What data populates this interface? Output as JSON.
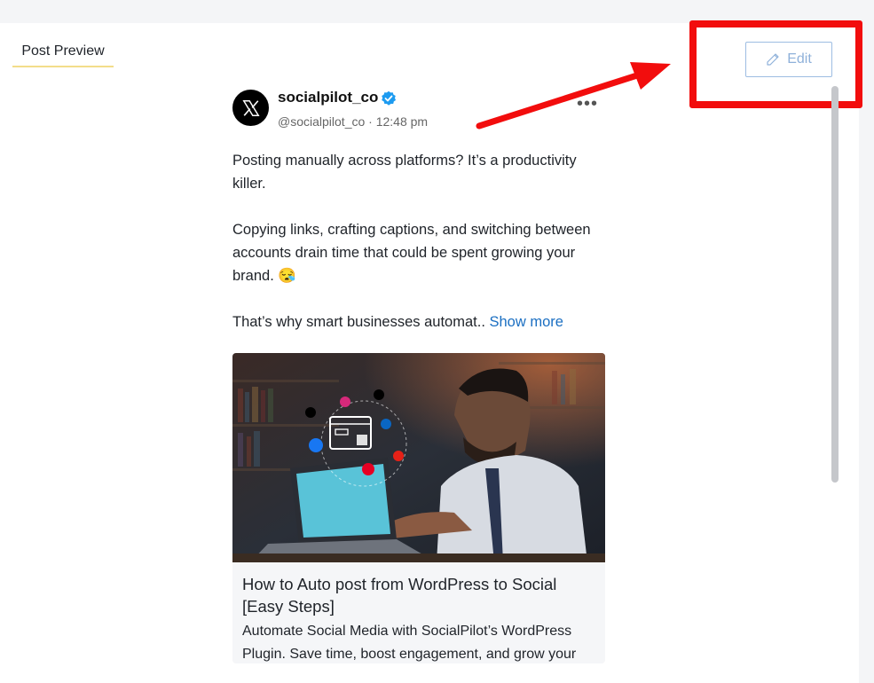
{
  "tab": {
    "label": "Post Preview"
  },
  "edit": {
    "label": "Edit"
  },
  "post": {
    "account_name": "socialpilot_co",
    "handle": "@socialpilot_co",
    "separator": "·",
    "time": "12:48 pm",
    "more": "•••",
    "paragraphs": [
      "Posting manually across platforms? It’s a productivity killer.",
      "Copying links, crafting captions, and switching between accounts drain time that could be spent growing your brand. 😪",
      "That’s why smart businesses automat.."
    ],
    "show_more": "Show more"
  },
  "card": {
    "title": "How to Auto post from WordPress to Social [Easy Steps]",
    "description": "Automate Social Media with SocialPilot’s WordPress Plugin. Save time, boost engagement, and grow your"
  },
  "colors": {
    "highlight": "#f20d0d",
    "link": "#1b6fc2",
    "tab_underline": "#f3dd8a",
    "verified": "#1d9bf0"
  }
}
